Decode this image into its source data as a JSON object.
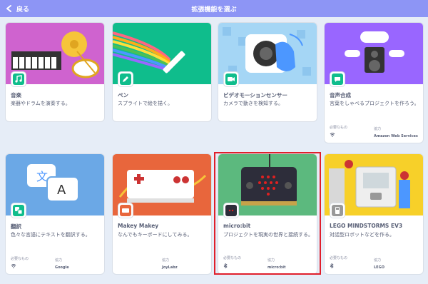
{
  "header": {
    "back_label": "戻る",
    "title": "拡張機能を選ぶ"
  },
  "meta_labels": {
    "requires": "必要なもの",
    "collab": "協力"
  },
  "cards": [
    {
      "name": "音楽",
      "description": "楽器やドラムを演奏する。"
    },
    {
      "name": "ペン",
      "description": "スプライトで絵を描く。"
    },
    {
      "name": "ビデオモーションセンサー",
      "description": "カメラで動きを検知する。"
    },
    {
      "name": "音声合成",
      "description": "言葉をしゃべるプロジェクトを作ろう。",
      "collaborator": "Amazon Web Services"
    },
    {
      "name": "翻訳",
      "description": "色々な言語にテキストを翻訳する。",
      "collaborator": "Google"
    },
    {
      "name": "Makey Makey",
      "description": "なんでもキーボードにしてみる。",
      "collaborator": "JoyLabz"
    },
    {
      "name": "micro:bit",
      "description": "プロジェクトを現実の世界と接続する。",
      "collaborator": "micro:bit"
    },
    {
      "name": "LEGO MINDSTORMS EV3",
      "description": "対話型ロボットなどを作る。",
      "collaborator": "LEGO"
    }
  ],
  "colors": {
    "header": "#8d95f5",
    "highlight": "#e01f2b",
    "music": "#cf63cf",
    "pen": "#0fbd8c",
    "video": "#a5d6f5",
    "tts": "#9966ff",
    "translate": "#6ba8e6",
    "makey": "#e8663c",
    "microbit": "#5cb97e",
    "lego": "#f7d029"
  }
}
